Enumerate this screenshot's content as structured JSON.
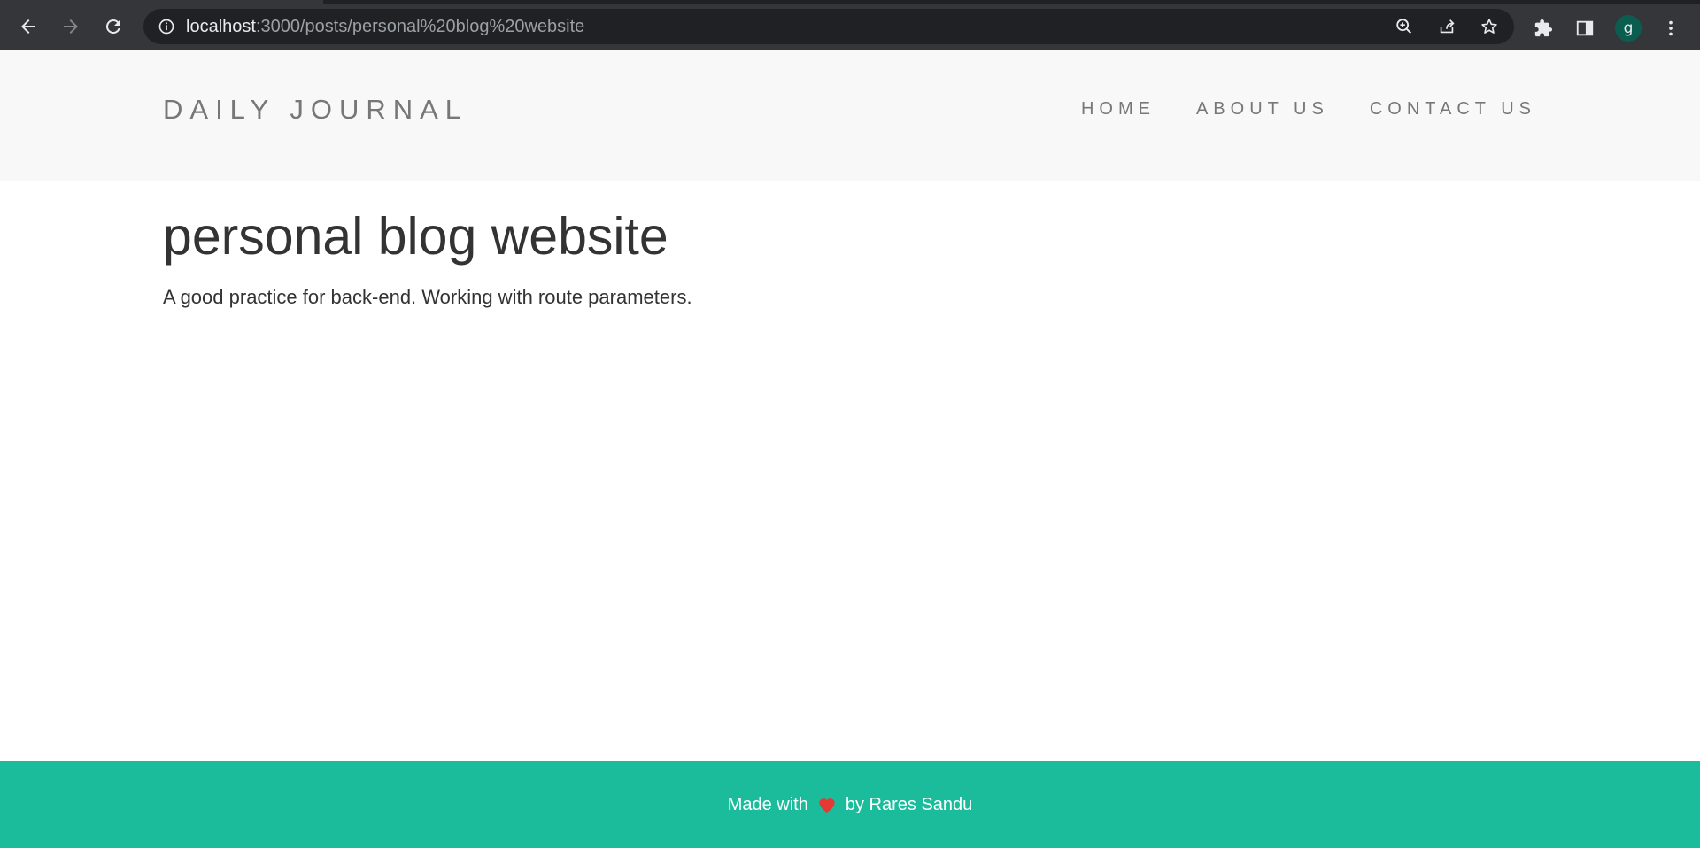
{
  "browser": {
    "url_host": "localhost",
    "url_rest": ":3000/posts/personal%20blog%20website",
    "profile_initial": "g",
    "icons": {
      "back": "arrow-left-icon",
      "forward": "arrow-right-icon",
      "reload": "reload-icon",
      "site_info": "info-circle-icon",
      "zoom": "zoom-in-icon",
      "share": "share-icon",
      "bookmark": "star-icon",
      "extensions": "puzzle-icon",
      "side_panel": "side-panel-icon",
      "menu": "kebab-menu-icon"
    },
    "colors": {
      "frame": "#35363a",
      "omnibox": "#202124",
      "avatar": "#0b5d4f"
    }
  },
  "site": {
    "brand": "DAILY JOURNAL",
    "nav": [
      {
        "label": "HOME"
      },
      {
        "label": "ABOUT US"
      },
      {
        "label": "CONTACT US"
      }
    ],
    "colors": {
      "header_bg": "#f8f8f8",
      "nav_text": "#777777"
    }
  },
  "post": {
    "title": "personal blog website",
    "body": "A good practice for back-end. Working with route parameters."
  },
  "footer": {
    "prefix": "Made with",
    "suffix": "by Rares Sandu",
    "icon": "heart-icon",
    "colors": {
      "bg": "#1abc9c",
      "heart": "#e53935"
    }
  }
}
